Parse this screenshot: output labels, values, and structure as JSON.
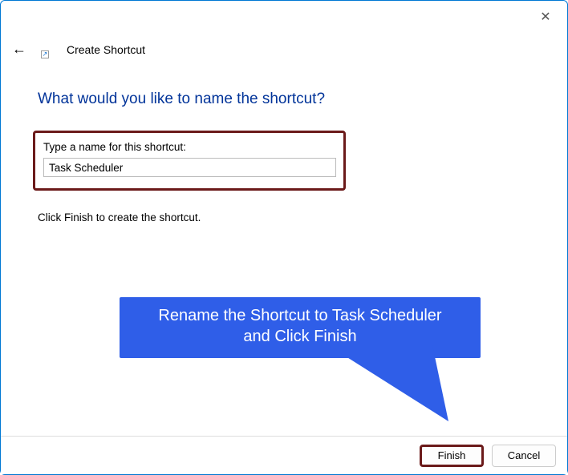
{
  "window": {
    "title": "Create Shortcut",
    "close_glyph": "✕",
    "back_glyph": "←",
    "shortcut_overlay_glyph": "↗"
  },
  "main": {
    "heading": "What would you like to name the shortcut?",
    "input_label": "Type a name for this shortcut:",
    "input_value": "Task Scheduler",
    "instruction": "Click Finish to create the shortcut."
  },
  "callout": {
    "line1": "Rename the Shortcut to Task Scheduler",
    "line2": "and Click Finish"
  },
  "footer": {
    "finish_label": "Finish",
    "cancel_label": "Cancel"
  },
  "colors": {
    "heading": "#003399",
    "highlight_border": "#6b1a1a",
    "callout_bg": "#2f5ee8"
  }
}
